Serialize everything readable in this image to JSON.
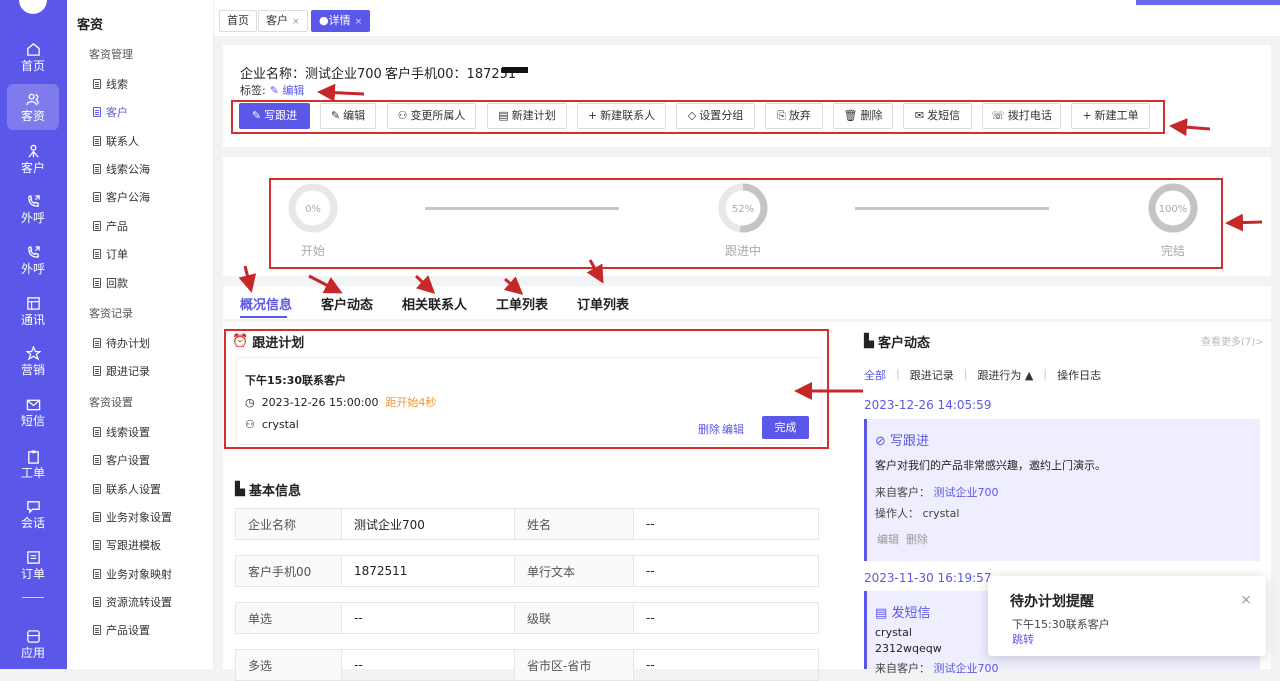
{
  "rail": {
    "items": [
      {
        "label": "首页",
        "icon": "home-icon"
      },
      {
        "label": "客资",
        "icon": "users-icon",
        "active": true
      },
      {
        "label": "客户",
        "icon": "person-icon"
      },
      {
        "label": "外呼",
        "icon": "phone-out-icon"
      },
      {
        "label": "外呼",
        "icon": "phone-out-icon"
      },
      {
        "label": "通讯",
        "icon": "grid-icon"
      },
      {
        "label": "营销",
        "icon": "marketing-icon"
      },
      {
        "label": "短信",
        "icon": "mail-icon"
      },
      {
        "label": "工单",
        "icon": "clipboard-icon"
      },
      {
        "label": "会话",
        "icon": "chat-icon"
      },
      {
        "label": "订单",
        "icon": "list-icon"
      },
      {
        "label": "应用",
        "icon": "app-icon"
      }
    ]
  },
  "menu": {
    "title": "客资",
    "groups": [
      {
        "label": "客资管理",
        "items": [
          "线索",
          "客户",
          "联系人",
          "线索公海",
          "客户公海",
          "产品",
          "订单",
          "回款"
        ]
      },
      {
        "label": "客资记录",
        "items": [
          "待办计划",
          "跟进记录"
        ]
      },
      {
        "label": "客资设置",
        "items": [
          "线索设置",
          "客户设置",
          "联系人设置",
          "业务对象设置",
          "写跟进模板",
          "业务对象映射",
          "资源流转设置",
          "产品设置"
        ]
      }
    ],
    "active": "客户"
  },
  "tabs": [
    {
      "label": "首页"
    },
    {
      "label": "客户"
    },
    {
      "label": "●详情"
    }
  ],
  "header": {
    "company_label": "企业名称：测试企业700",
    "phone_label": "客户手机00：187251",
    "tag_label": "标签:",
    "tag_edit": "编辑"
  },
  "actions": [
    "写跟进",
    "编辑",
    "变更所属人",
    "新建计划",
    "新建联系人",
    "设置分组",
    "放弃",
    "删除",
    "发短信",
    "拨打电话",
    "新建工单"
  ],
  "progress": {
    "steps": [
      {
        "pct": "0%",
        "label": "开始",
        "fraction": 0
      },
      {
        "pct": "52%",
        "label": "跟进中",
        "fraction": 0.52
      },
      {
        "pct": "100%",
        "label": "完结",
        "fraction": 1
      }
    ]
  },
  "subtabs": [
    "概况信息",
    "客户动态",
    "相关联系人",
    "工单列表",
    "订单列表"
  ],
  "plan": {
    "title": "跟进计划",
    "item_title": "下午15:30联系客户",
    "datetime": "2023-12-26 15:00:00",
    "countdown": "距开始4秒",
    "owner": "crystal",
    "delete": "删除",
    "edit": "编辑",
    "done": "完成"
  },
  "basic": {
    "title": "基本信息",
    "rows": [
      [
        "企业名称",
        "测试企业700",
        "姓名",
        "--"
      ],
      [
        "客户手机00",
        "1872511",
        "单行文本",
        "--"
      ],
      [
        "单选",
        "--",
        "级联",
        "--"
      ],
      [
        "多选",
        "--",
        "省市区-省市",
        "--"
      ]
    ]
  },
  "dynamics": {
    "title": "客户动态",
    "more": "查看更多(7)>",
    "filters": [
      "全部",
      "跟进记录",
      "跟进行为 ▲",
      "操作日志"
    ],
    "entries": [
      {
        "date": "2023-12-26 14:05:59",
        "type": "写跟进",
        "content": "客户对我们的产品非常感兴趣，邀约上门演示。",
        "from_label": "来自客户：",
        "from": "测试企业700",
        "op_label": "操作人：",
        "op": "crystal",
        "edit": "编辑",
        "delete": "删除"
      },
      {
        "date": "2023-11-30 16:19:57",
        "type": "发短信",
        "line1": "crystal",
        "line2": "2312wqeqw",
        "from_label": "来自客户：",
        "from": "测试企业700"
      }
    ]
  },
  "toast": {
    "title": "待办计划提醒",
    "body": "下午15:30联系客户",
    "link": "跳转"
  }
}
